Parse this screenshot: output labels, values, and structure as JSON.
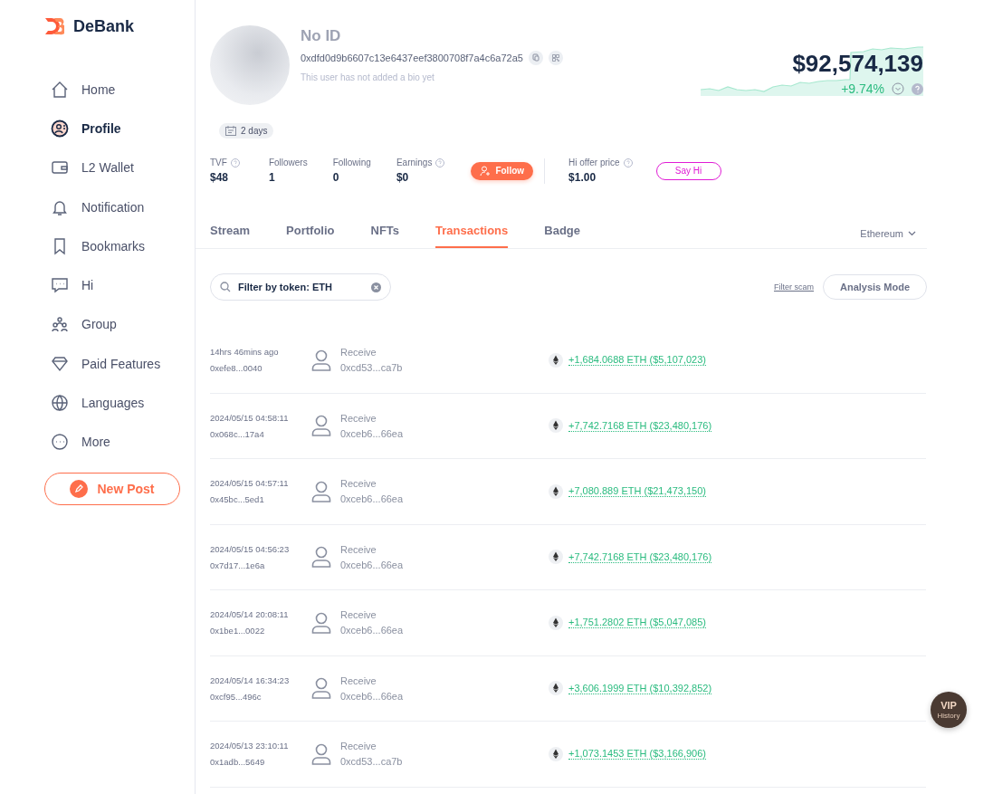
{
  "brand": "DeBank",
  "nav": [
    {
      "label": "Home",
      "selected": false
    },
    {
      "label": "Profile",
      "selected": true
    },
    {
      "label": "L2 Wallet",
      "selected": false
    },
    {
      "label": "Notification",
      "selected": false
    },
    {
      "label": "Bookmarks",
      "selected": false
    },
    {
      "label": "Hi",
      "selected": false
    },
    {
      "label": "Group",
      "selected": false
    },
    {
      "label": "Paid Features",
      "selected": false
    },
    {
      "label": "Languages",
      "selected": false
    },
    {
      "label": "More",
      "selected": false
    }
  ],
  "new_post": "New Post",
  "profile": {
    "name": "No ID",
    "address": "0xdfd0d9b6607c13e6437eef3800708f7a4c6a72a5",
    "bio": "This user has not added a bio yet",
    "age": "2 days"
  },
  "net_worth": {
    "value": "$92,574,139",
    "change": "+9.74%"
  },
  "stats": [
    {
      "label": "TVF",
      "value": "$48",
      "help": true
    },
    {
      "label": "Followers",
      "value": "1",
      "help": false
    },
    {
      "label": "Following",
      "value": "0",
      "help": false
    },
    {
      "label": "Earnings",
      "value": "$0",
      "help": true
    }
  ],
  "follow_button": "Follow",
  "hi_offer": {
    "label": "Hi offer price",
    "value": "$1.00",
    "button": "Say Hi"
  },
  "tabs": [
    {
      "label": "Stream",
      "selected": false
    },
    {
      "label": "Portfolio",
      "selected": false
    },
    {
      "label": "NFTs",
      "selected": false
    },
    {
      "label": "Transactions",
      "selected": true
    },
    {
      "label": "Badge",
      "selected": false
    }
  ],
  "chain_select": "Ethereum",
  "filter": {
    "value": "Filter by token: ETH"
  },
  "filter_scam": "Filter scam",
  "analysis_mode": "Analysis Mode",
  "transactions": [
    {
      "time": "14hrs 46mins ago",
      "hash": "0xefe8...0040",
      "type": "Receive",
      "address": "0xcd53...ca7b",
      "amount": "+1,684.0688 ETH ($5,107,023)"
    },
    {
      "time": "2024/05/15 04:58:11",
      "hash": "0x068c...17a4",
      "type": "Receive",
      "address": "0xceb6...66ea",
      "amount": "+7,742.7168 ETH ($23,480,176)"
    },
    {
      "time": "2024/05/15 04:57:11",
      "hash": "0x45bc...5ed1",
      "type": "Receive",
      "address": "0xceb6...66ea",
      "amount": "+7,080.889 ETH ($21,473,150)"
    },
    {
      "time": "2024/05/15 04:56:23",
      "hash": "0x7d17...1e6a",
      "type": "Receive",
      "address": "0xceb6...66ea",
      "amount": "+7,742.7168 ETH ($23,480,176)"
    },
    {
      "time": "2024/05/14 20:08:11",
      "hash": "0x1be1...0022",
      "type": "Receive",
      "address": "0xceb6...66ea",
      "amount": "+1,751.2802 ETH ($5,047,085)"
    },
    {
      "time": "2024/05/14 16:34:23",
      "hash": "0xcf95...496c",
      "type": "Receive",
      "address": "0xceb6...66ea",
      "amount": "+3,606.1999 ETH ($10,392,852)"
    },
    {
      "time": "2024/05/13 23:10:11",
      "hash": "0x1adb...5649",
      "type": "Receive",
      "address": "0xcd53...ca7b",
      "amount": "+1,073.1453 ETH ($3,166,906)"
    }
  ],
  "vip": {
    "title": "VIP",
    "subtitle": "History"
  }
}
